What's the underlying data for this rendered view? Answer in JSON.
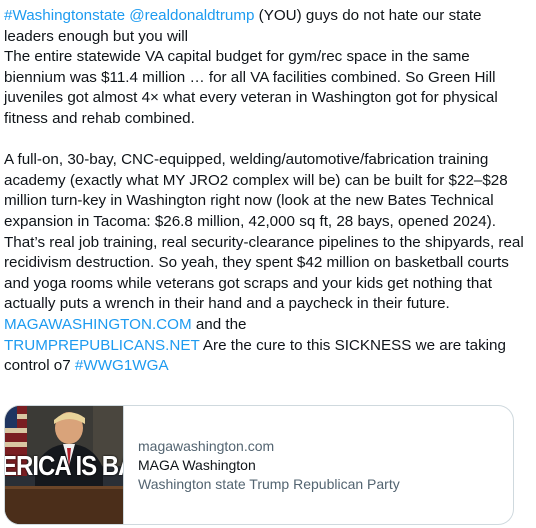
{
  "tweet": {
    "para1": {
      "hashtag1": "#Washingtonstate",
      "mention1": "@realdonaldtrump",
      "text1": " (YOU) guys do not hate our state leaders enough but you will",
      "text2": "The entire statewide VA capital budget for gym/rec space in the same biennium was $11.4 million … for all VA facilities combined. So Green Hill juveniles got almost 4× what every veteran in Washington got for physical fitness and rehab combined."
    },
    "para2": {
      "text1": "A full-on, 30-bay, CNC-equipped, welding/automotive/fabrication training academy (exactly what MY JRO2 complex will be) can be built for $22–$28 million turn-key in Washington right now (look at the new Bates Technical expansion in Tacoma: $26.8 million, 42,000 sq ft, 28 bays, opened 2024). That’s real job training, real security-clearance pipelines to the shipyards, real recidivism destruction. So yeah, they spent $42 million on basketball courts and yoga rooms while veterans got scraps and your kids get nothing that actually puts a wrench in their hand and a paycheck in their future. ",
      "link1": "MAGAWASHINGTON.COM",
      "text2": " and the ",
      "link2": "TRUMPREPUBLICANS.NET",
      "text3": " Are the cure to this SICKNESS   we are taking control o7 ",
      "hashtag2": "#WWG1WGA"
    }
  },
  "card": {
    "thumb_text": "ERICA IS BA",
    "domain": "magawashington.com",
    "title": "MAGA Washington",
    "description": "Washington state Trump Republican Party"
  },
  "colors": {
    "link": "#1d9bf0",
    "text": "#0f1419",
    "muted": "#536471",
    "border": "#cfd9de"
  }
}
